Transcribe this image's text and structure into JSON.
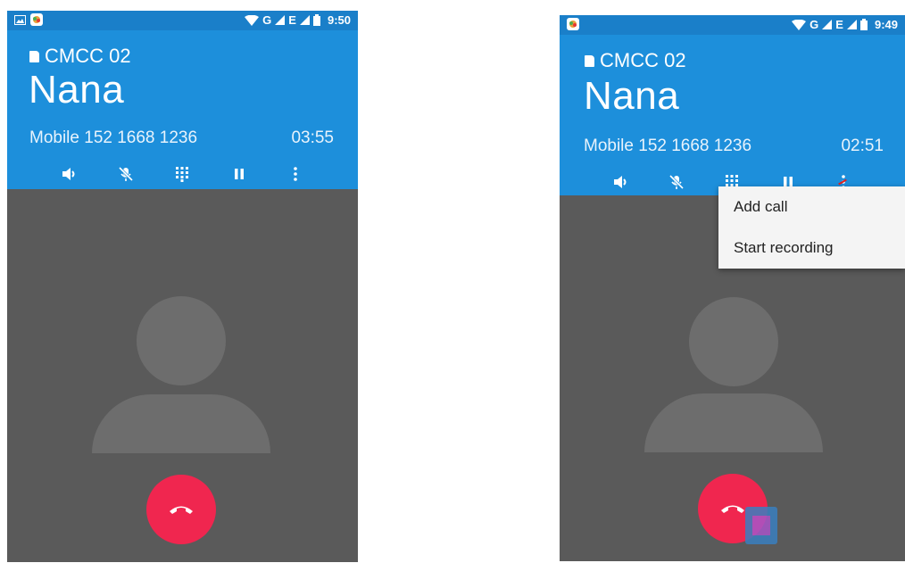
{
  "screens": [
    {
      "status_bar": {
        "time": "9:50",
        "left_icons": [
          "image-notification-icon",
          "app-notification-icon"
        ],
        "right_icons": [
          "wifi-icon",
          "signal-g-icon",
          "signal-e-icon",
          "battery-icon"
        ],
        "network_g": "G",
        "network_e": "E"
      },
      "call": {
        "sim_label": "CMCC 02",
        "caller_name": "Nana",
        "number_label": "Mobile 152 1668 1236",
        "timer": "03:55"
      },
      "controls": [
        "speaker-icon",
        "mute-icon",
        "dialpad-icon",
        "pause-icon",
        "more-options-icon"
      ],
      "end_call_color": "#f0264f"
    },
    {
      "status_bar": {
        "time": "9:49",
        "left_icons": [
          "app-notification-icon"
        ],
        "right_icons": [
          "wifi-icon",
          "signal-g-icon",
          "signal-e-icon",
          "battery-icon"
        ],
        "network_g": "G",
        "network_e": "E"
      },
      "call": {
        "sim_label": "CMCC 02",
        "caller_name": "Nana",
        "number_label": "Mobile 152 1668 1236",
        "timer": "02:51"
      },
      "controls": [
        "speaker-icon",
        "mute-icon",
        "dialpad-icon",
        "pause-icon",
        "more-options-icon"
      ],
      "overflow_menu": {
        "items": [
          "Add call",
          "Start recording"
        ]
      },
      "end_call_color": "#f0264f"
    }
  ],
  "colors": {
    "header": "#1d8fdb",
    "status_bar": "#1a7fc9",
    "background": "#5a5a5a",
    "end_call": "#f0264f"
  }
}
